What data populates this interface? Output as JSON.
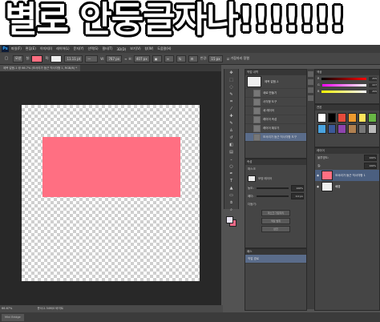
{
  "banner": {
    "text": "별로 안둥글자나!!!!!!!"
  },
  "menubar": {
    "logo": "Ps",
    "items": [
      "파일(F)",
      "편집(E)",
      "이미지(I)",
      "레이어(L)",
      "문자(Y)",
      "선택(S)",
      "필터(T)",
      "3D(D)",
      "보기(V)",
      "창(W)",
      "도움말(H)"
    ]
  },
  "options": {
    "shape_mode": "모양",
    "fill_label": "칠:",
    "stroke_label": "획:",
    "stroke_width": "11.11 pt",
    "w_label": "W:",
    "w_value": "767 px",
    "link_icon": "link-icon",
    "h_label": "H:",
    "h_value": "407 px",
    "radius_label": "반경:",
    "radius_value": "15 px",
    "align_edges": "가장자리 정렬",
    "fill_color": "#ff6f81"
  },
  "tab": {
    "title": "제목 없음-1 @ 66.7% (모서리가 둥근 직사각형 1, RGB/8) *"
  },
  "status": {
    "zoom": "66.67%",
    "doc": "문서:2.34M/0 바이트"
  },
  "bottom": {
    "label": "Mini Bridge"
  },
  "history": {
    "header": "작업 내역",
    "snapshot": "제목 없음-1",
    "items": [
      "새로 만들기",
      "사각형 도구",
      "새 레이어",
      "레이어 속성",
      "레이어 채우기",
      "모서리가 둥근 직사각형 도구"
    ]
  },
  "properties": {
    "header": "속성",
    "sub": "마스크",
    "mask_label": "모양 레이어",
    "density_label": "농도:",
    "density_value": "100%",
    "feather_label": "페더:",
    "feather_value": "0.0 px",
    "refine_label": "다듬기:",
    "refine_btn": "마스크 가장자리",
    "color_range_btn": "색상 범위",
    "invert_btn": "반전"
  },
  "color": {
    "header": "색상",
    "r_label": "R",
    "r_value": "255",
    "g_label": "G",
    "g_value": "227",
    "b_label": "B",
    "b_value": "255"
  },
  "swatches": {
    "header": "견본"
  },
  "layers": {
    "header": "레이어",
    "opacity_label": "불투명도:",
    "opacity_value": "100%",
    "fill_label": "칠:",
    "fill_value": "100%",
    "layer_name": "모서리가 둥근 직사각형 1",
    "bg_name": "배경"
  },
  "paths": {
    "header": "패스",
    "item": "작업 경로"
  },
  "canvas": {
    "shape_color": "#ff6f82"
  }
}
